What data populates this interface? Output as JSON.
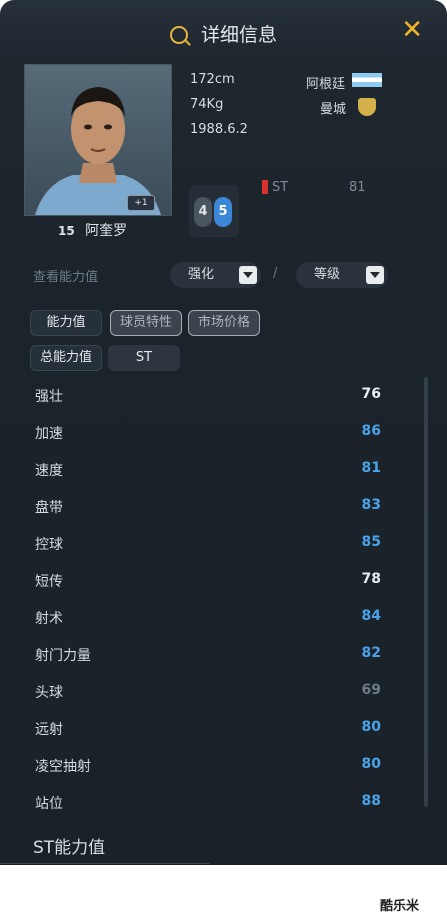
{
  "header": {
    "title": "详细信息",
    "close_icon": "close-icon"
  },
  "player": {
    "number": "15",
    "name": "阿奎罗",
    "height": "172cm",
    "weight": "74Kg",
    "birth": "1988.6.2",
    "nation": "阿根廷",
    "club": "曼城",
    "photo_badge": "+1",
    "weak_foot": "4",
    "skill_moves": "5",
    "position": "ST",
    "position_rating": "81"
  },
  "view": {
    "label": "查看能力值",
    "enhance_label": "强化",
    "separator": "/",
    "grade_label": "等级"
  },
  "tabs": [
    {
      "label": "能力值"
    },
    {
      "label": "球员特性"
    },
    {
      "label": "市场价格"
    }
  ],
  "subtabs": [
    {
      "label": "总能力值"
    },
    {
      "label": "ST"
    }
  ],
  "stats": [
    {
      "name": "强壮",
      "value": "76",
      "color": "#e9edf0"
    },
    {
      "name": "加速",
      "value": "86",
      "color": "#4aa3e8"
    },
    {
      "name": "速度",
      "value": "81",
      "color": "#4aa3e8"
    },
    {
      "name": "盘带",
      "value": "83",
      "color": "#4aa3e8"
    },
    {
      "name": "控球",
      "value": "85",
      "color": "#4aa3e8"
    },
    {
      "name": "短传",
      "value": "78",
      "color": "#e9edf0"
    },
    {
      "name": "射术",
      "value": "84",
      "color": "#4aa3e8"
    },
    {
      "name": "射门力量",
      "value": "82",
      "color": "#4aa3e8"
    },
    {
      "name": "头球",
      "value": "69",
      "color": "#6f7b86"
    },
    {
      "name": "远射",
      "value": "80",
      "color": "#4aa3e8"
    },
    {
      "name": "凌空抽射",
      "value": "80",
      "color": "#4aa3e8"
    },
    {
      "name": "站位",
      "value": "88",
      "color": "#4aa3e8"
    }
  ],
  "bottom": {
    "label": "ST能力值"
  },
  "watermark": "酷乐米",
  "colors": {
    "accent": "#f0b52a",
    "stat_blue": "#4aa3e8",
    "panel": "#1b232b"
  }
}
